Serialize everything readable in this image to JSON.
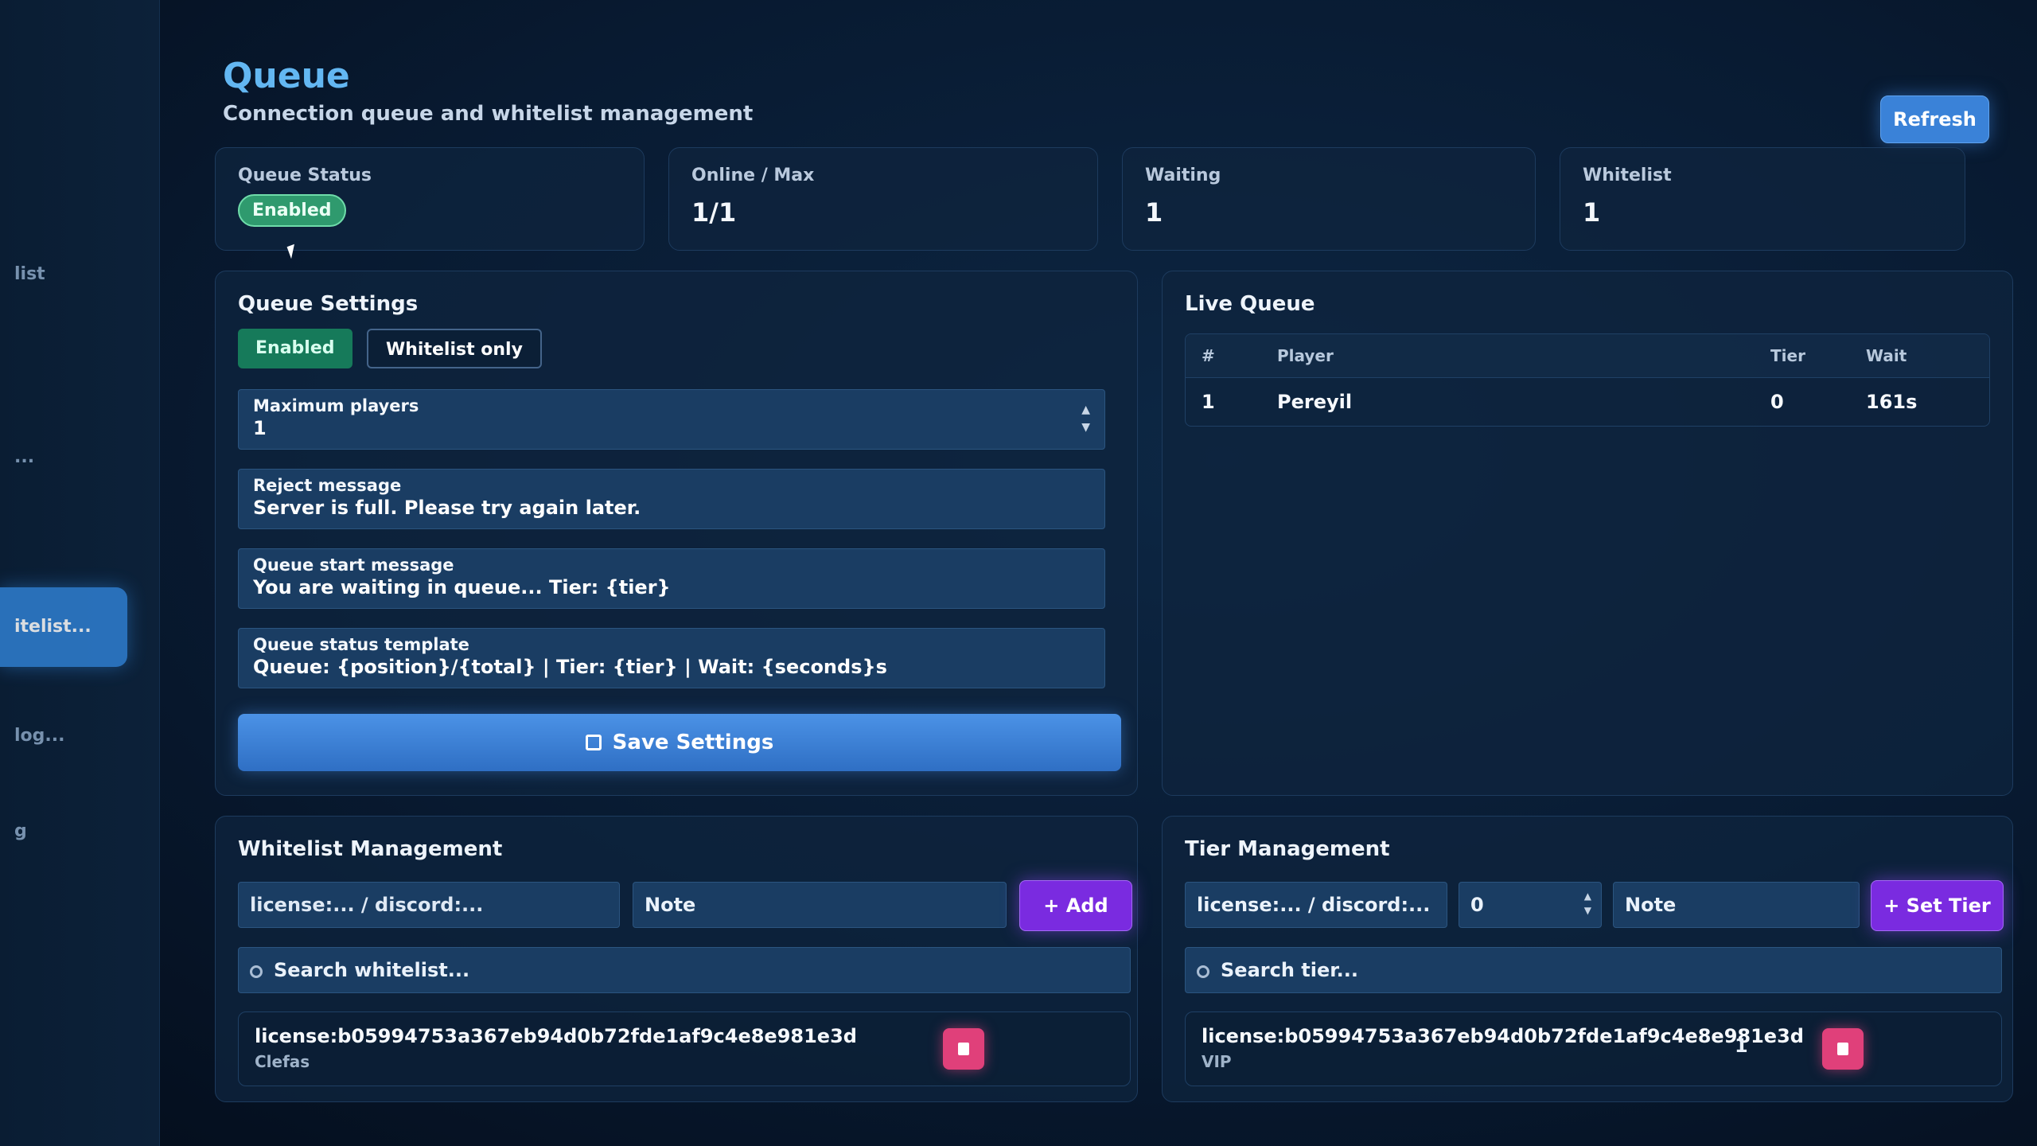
{
  "sidebar": {
    "items": [
      {
        "label": ""
      },
      {
        "label": ""
      },
      {
        "label": "list"
      },
      {
        "label": ""
      },
      {
        "label": "..."
      },
      {
        "label": "itelist..."
      },
      {
        "label": "log..."
      },
      {
        "label": "g"
      }
    ]
  },
  "header": {
    "title": "Queue",
    "subtitle": "Connection queue and whitelist management",
    "refresh_label": "Refresh"
  },
  "stats": {
    "queue_status_label": "Queue Status",
    "queue_status_value": "Enabled",
    "online_label": "Online / Max",
    "online_value": "1/1",
    "waiting_label": "Waiting",
    "waiting_value": "1",
    "whitelist_label": "Whitelist",
    "whitelist_value": "1"
  },
  "settings": {
    "title": "Queue Settings",
    "enabled_label": "Enabled",
    "whitelist_only_label": "Whitelist only",
    "max_players_label": "Maximum players",
    "max_players_value": "1",
    "reject_label": "Reject message",
    "reject_value": "Server is full. Please try again later.",
    "start_label": "Queue start message",
    "start_value": "You are waiting in queue... Tier: {tier}",
    "template_label": "Queue status template",
    "template_value": "Queue: {position}/{total} | Tier: {tier} | Wait: {seconds}s",
    "save_label": "Save Settings"
  },
  "live_queue": {
    "title": "Live Queue",
    "columns": {
      "num": "#",
      "player": "Player",
      "tier": "Tier",
      "wait": "Wait"
    },
    "rows": [
      {
        "num": "1",
        "player": "Pereyil",
        "tier": "0",
        "wait": "161s"
      }
    ]
  },
  "whitelist": {
    "title": "Whitelist Management",
    "id_placeholder": "license:... / discord:...",
    "note_placeholder": "Note",
    "add_label": "+ Add",
    "search_placeholder": "Search whitelist...",
    "entries": [
      {
        "id": "license:b05994753a367eb94d0b72fde1af9c4e8e981e3d",
        "note": "Clefas"
      }
    ]
  },
  "tiers": {
    "title": "Tier Management",
    "id_placeholder": "license:... / discord:...",
    "tier_value": "0",
    "note_placeholder": "Note",
    "set_label": "+ Set Tier",
    "search_placeholder": "Search tier...",
    "entries": [
      {
        "id": "license:b05994753a367eb94d0b72fde1af9c4e8e981e3d",
        "note": "VIP",
        "tier": "1"
      }
    ]
  }
}
